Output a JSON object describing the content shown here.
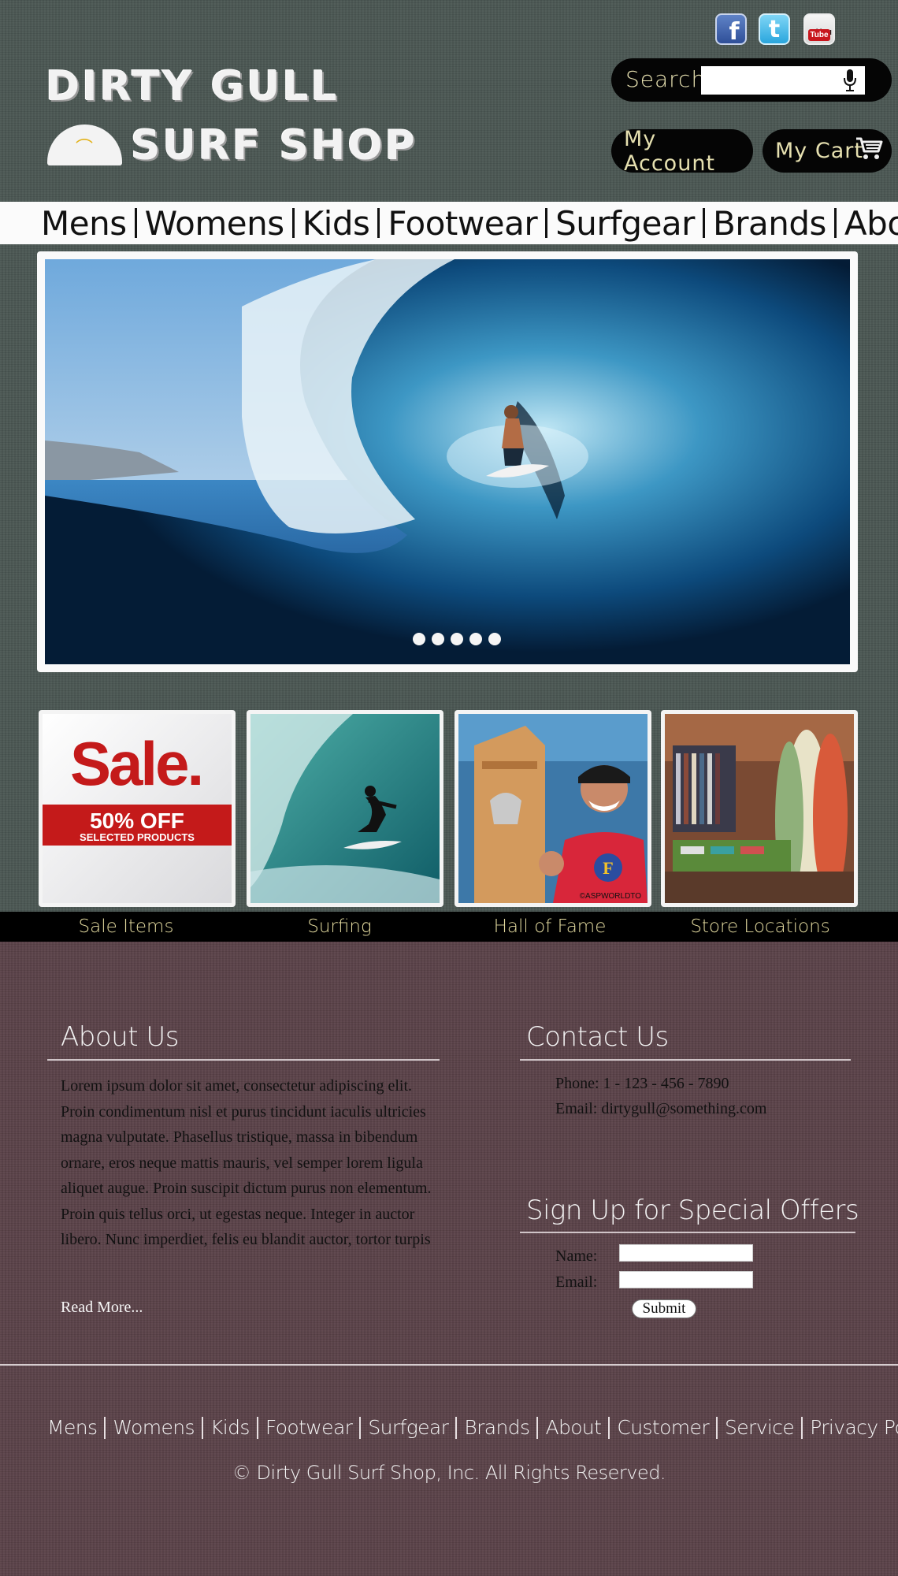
{
  "brand": {
    "line1": "DIRTY GULL",
    "line2": "SURF SHOP"
  },
  "header": {
    "search_label": "Search",
    "search_value": "",
    "account_label": "My Account",
    "cart_label": "My Cart"
  },
  "nav": {
    "items": [
      "Mens",
      "Womens",
      "Kids",
      "Footwear",
      "Surfgear",
      "Brands",
      "About"
    ]
  },
  "hero": {
    "slide_count": 5
  },
  "thumbs": {
    "sale_word": "Sale.",
    "sale_pct": "50% OFF",
    "sale_sub": "SELECTED PRODUCTS",
    "watermark": "©ASPWORLDTO",
    "captions": [
      "Sale Items",
      "Surfing",
      "Hall of Fame",
      "Store Locations"
    ]
  },
  "about": {
    "title": "About Us",
    "body": "Lorem ipsum dolor sit amet, consectetur adipiscing elit. Proin condimentum nisl et purus tincidunt iaculis ultricies magna vulputate. Phasellus tristique, massa in bibendum ornare, eros neque mattis mauris, vel semper lorem ligula aliquet augue. Proin suscipit dictum purus non elementum. Proin quis tellus orci, ut egestas neque. Integer in auctor libero. Nunc imperdiet, felis eu blandit auctor, tortor turpis",
    "read_more": "Read More..."
  },
  "contact": {
    "title": "Contact Us",
    "phone": "Phone: 1 - 123 - 456 - 7890",
    "email": "Email: dirtygull@something.com"
  },
  "signup": {
    "title": "Sign Up for Special Offers",
    "name_label": "Name:",
    "email_label": "Email:",
    "name_value": "",
    "email_value": "",
    "submit_label": "Submit"
  },
  "footer": {
    "items": [
      "Mens",
      "Womens",
      "Kids",
      "Footwear",
      "Surfgear",
      "Brands",
      "About",
      "Customer",
      "Service",
      "Privacy Policy"
    ],
    "copyright": "© Dirty Gull Surf Shop, Inc. All Rights Reserved."
  },
  "colors": {
    "top_background": "#4b5753",
    "bottom_background": "#5b4249",
    "pill_text": "#e6e0b0",
    "caption_text": "#e3da9f"
  }
}
